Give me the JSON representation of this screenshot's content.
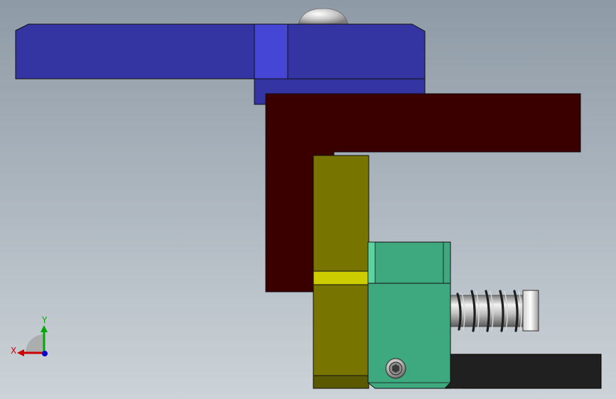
{
  "viewport": {
    "background_top": "#8e9aa6",
    "background_bottom": "#ccd3d8"
  },
  "colors": {
    "clamp_arm": "#3434a2",
    "clamp_arm_highlight": "#4545d6",
    "bracket": "#3a0000",
    "column": "#777400",
    "column_band": "#cccc00",
    "block": "#3ea87e",
    "block_highlight": "#5dd3a0",
    "base_plate": "#202020",
    "spring": "#9a9a9a"
  },
  "icons": {
    "dome": "dome-knob-icon",
    "screw": "socket-screw-icon",
    "spring": "compression-spring-icon",
    "triad": "axis-triad-icon"
  },
  "triad": {
    "x_label": "X",
    "y_label": "Y",
    "x_color": "#cc0000",
    "y_color": "#00aa00",
    "z_color": "#0000cc"
  }
}
